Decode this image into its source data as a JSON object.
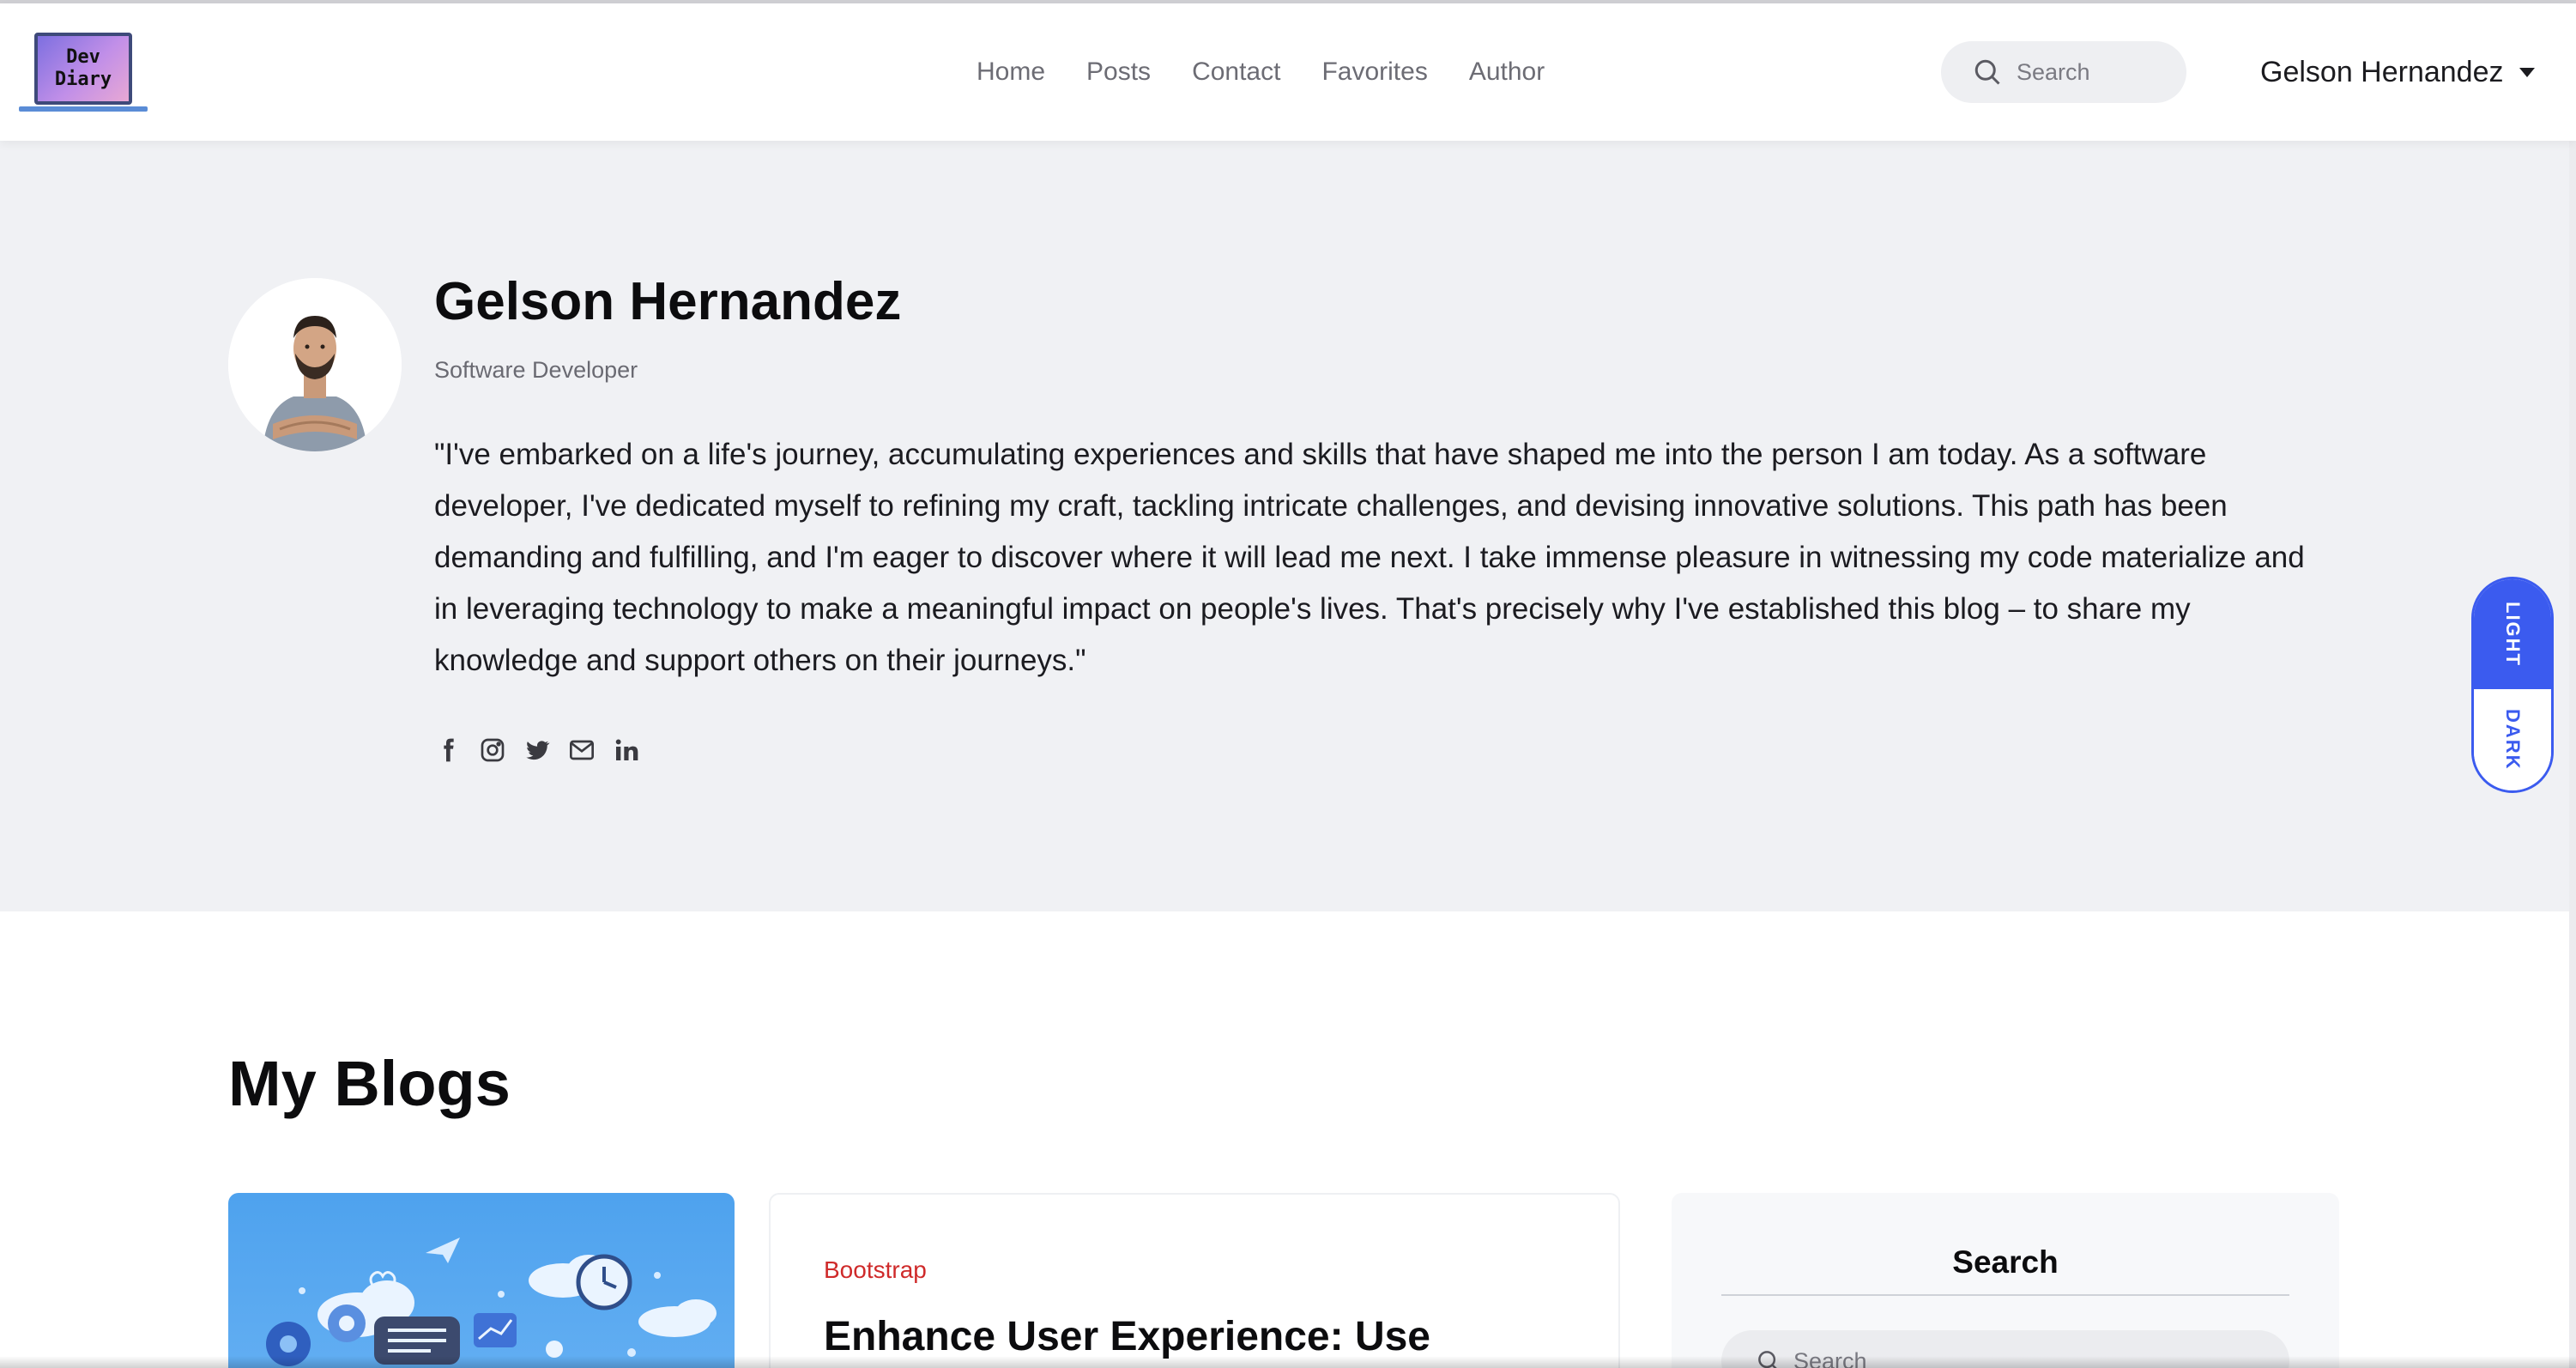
{
  "logo": {
    "line1": "Dev",
    "line2": "Diary"
  },
  "nav": {
    "links": [
      "Home",
      "Posts",
      "Contact",
      "Favorites",
      "Author"
    ],
    "search_placeholder": "Search",
    "user_name": "Gelson Hernandez"
  },
  "author": {
    "name": "Gelson Hernandez",
    "role": "Software Developer",
    "bio": "\"I've embarked on a life's journey, accumulating experiences and skills that have shaped me into the person I am today. As a software developer, I've dedicated myself to refining my craft, tackling intricate challenges, and devising innovative solutions. This path has been demanding and fulfilling, and I'm eager to discover where it will lead me next. I take immense pleasure in witnessing my code materialize and in leveraging technology to make a meaningful impact on people's lives. That's precisely why I've established this blog – to share my knowledge and support others on their journeys.\"",
    "socials": [
      "facebook-icon",
      "instagram-icon",
      "twitter-icon",
      "email-icon",
      "linkedin-icon"
    ]
  },
  "theme_toggle": {
    "light_label": "LIGHT",
    "dark_label": "DARK",
    "active": "light",
    "accent": "#3b5bef"
  },
  "blogs": {
    "heading": "My Blogs",
    "first_post": {
      "tag": "Bootstrap",
      "title": "Enhance User Experience: Use"
    }
  },
  "sidebar": {
    "search_title": "Search",
    "search_placeholder": "Search"
  },
  "colors": {
    "tag_red": "#cf2a2a",
    "hero_bg": "#f0f1f4"
  }
}
